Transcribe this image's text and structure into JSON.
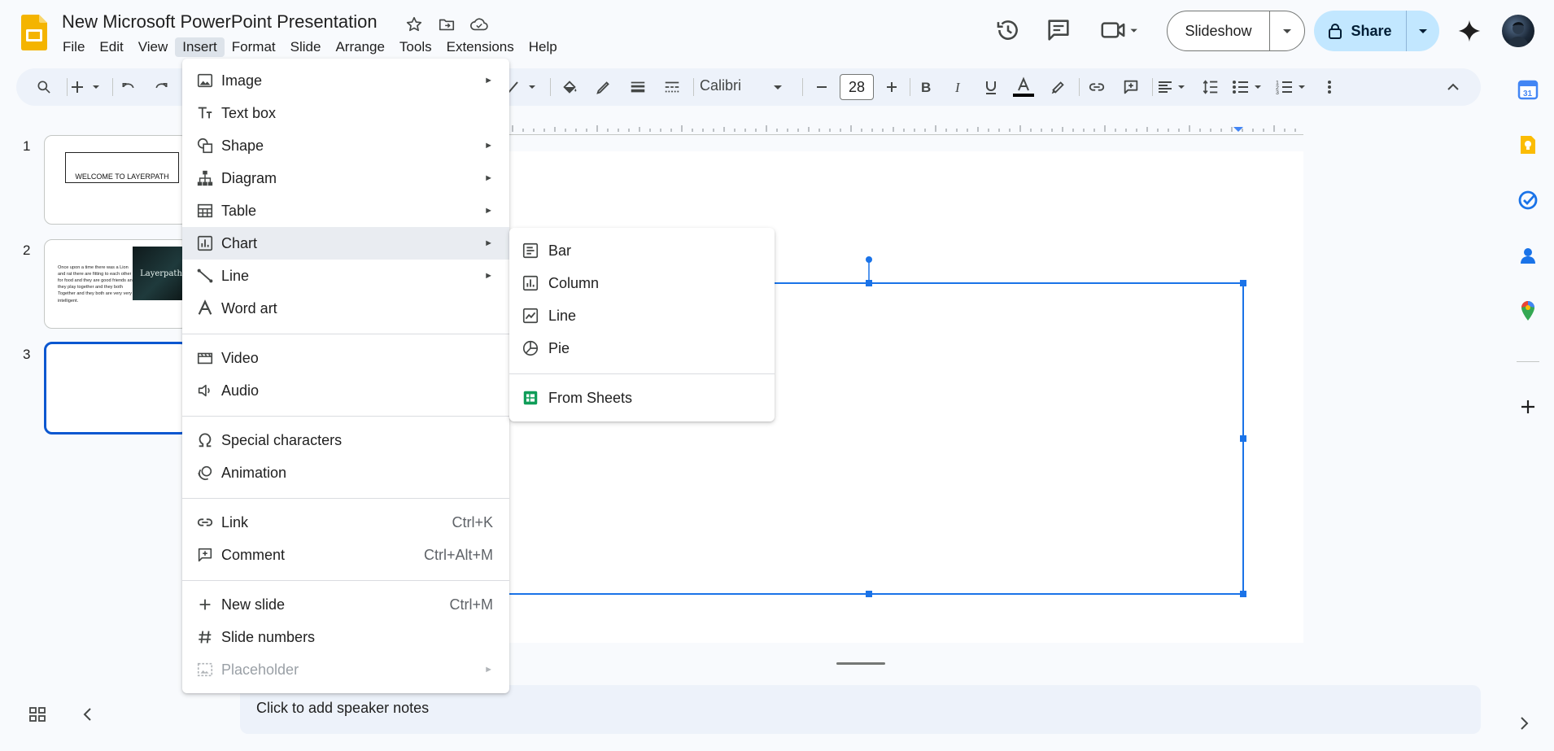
{
  "doc": {
    "title": "New Microsoft PowerPoint Presentation"
  },
  "menubar": [
    "File",
    "Edit",
    "View",
    "Insert",
    "Format",
    "Slide",
    "Arrange",
    "Tools",
    "Extensions",
    "Help"
  ],
  "header": {
    "slideshow_label": "Slideshow",
    "share_label": "Share"
  },
  "toolbar": {
    "font_name": "Calibri",
    "font_size": "28"
  },
  "slides": [
    {
      "number": "1",
      "title": "WELCOME TO LAYERPATH"
    },
    {
      "number": "2",
      "body": "Once upon a time there was a Lion and rat there are fitting to each other for food and they are good friends and they play together and they both Together and they both are very very intelligent.",
      "image_text": "Layerpath"
    },
    {
      "number": "3"
    }
  ],
  "insert_menu": {
    "image": "Image",
    "text_box": "Text box",
    "shape": "Shape",
    "diagram": "Diagram",
    "table": "Table",
    "chart": "Chart",
    "line": "Line",
    "word_art": "Word art",
    "video": "Video",
    "audio": "Audio",
    "special_characters": "Special characters",
    "animation": "Animation",
    "link": "Link",
    "link_shortcut": "Ctrl+K",
    "comment": "Comment",
    "comment_shortcut": "Ctrl+Alt+M",
    "new_slide": "New slide",
    "new_slide_shortcut": "Ctrl+M",
    "slide_numbers": "Slide numbers",
    "placeholder": "Placeholder"
  },
  "chart_menu": {
    "bar": "Bar",
    "column": "Column",
    "line": "Line",
    "pie": "Pie",
    "from_sheets": "From Sheets"
  },
  "notes": {
    "placeholder": "Click to add speaker notes"
  },
  "colors": {
    "accent": "#0b57d0",
    "share_bg": "#c2e7ff",
    "selection": "#1a73e8",
    "slides_logo": "#f4b400",
    "sheets_green": "#0f9d58"
  }
}
